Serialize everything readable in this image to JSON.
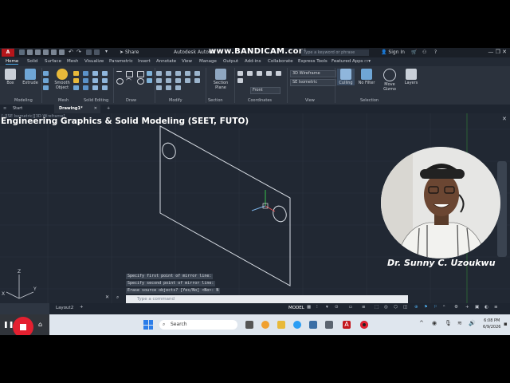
{
  "titlebar": {
    "app_logo": "A",
    "share_label": "Share",
    "app_title": "Autodesk AutoCA",
    "watermark": "www.BANDICAM.com",
    "search_placeholder": "Type a keyword or phrase",
    "signin_label": "Sign In",
    "window_controls": "—  ❐  ✕"
  },
  "ribbon_tabs": [
    "Home",
    "Solid",
    "Surface",
    "Mesh",
    "Visualize",
    "Parametric",
    "Insert",
    "Annotate",
    "View",
    "Manage",
    "Output",
    "Add-ins",
    "Collaborate",
    "Express Tools",
    "Featured Apps"
  ],
  "ribbon": {
    "box_label": "Box",
    "extrude_label": "Extrude",
    "smooth_label": "Smooth Object",
    "section_plane_label": "Section Plane",
    "visual_style": "3D Wireframe",
    "view_direction": "SE Isometric",
    "ucs_front": "Front",
    "culling_label": "Culling",
    "nofilter_label": "No Filter",
    "gizmo_label": "Move Gizmo",
    "layers_label": "Layers",
    "panels": [
      "Modeling",
      "Mesh",
      "Solid Editing",
      "Draw",
      "Modify",
      "Section",
      "Coordinates",
      "View",
      "Selection"
    ]
  },
  "doc_tabs": {
    "start": "Start",
    "drawing": "Drawing1*",
    "add": "+"
  },
  "viewport": {
    "label": "[-][SE Isometric][3D Wireframe]",
    "overlay_title": "Engineering Graphics & Solid  Modeling (SEET, FUTO)",
    "presenter_name": "Dr. Sunny C. Uzoukwu"
  },
  "command": {
    "history": [
      "Specify first point of mirror line:",
      "Specify second point of mirror line:",
      "Erase source objects? [Yes/No] <No>: N"
    ],
    "prompt_placeholder": "Type a command"
  },
  "status": {
    "layout_tab": "Layout2",
    "model_label": "MODEL"
  },
  "taskbar": {
    "search_label": "Search",
    "time": "6:08 PM",
    "date": "6/9/2026"
  },
  "colors": {
    "accent": "#4aa3df",
    "record": "#e42030",
    "viewport_bg": "#212833"
  }
}
